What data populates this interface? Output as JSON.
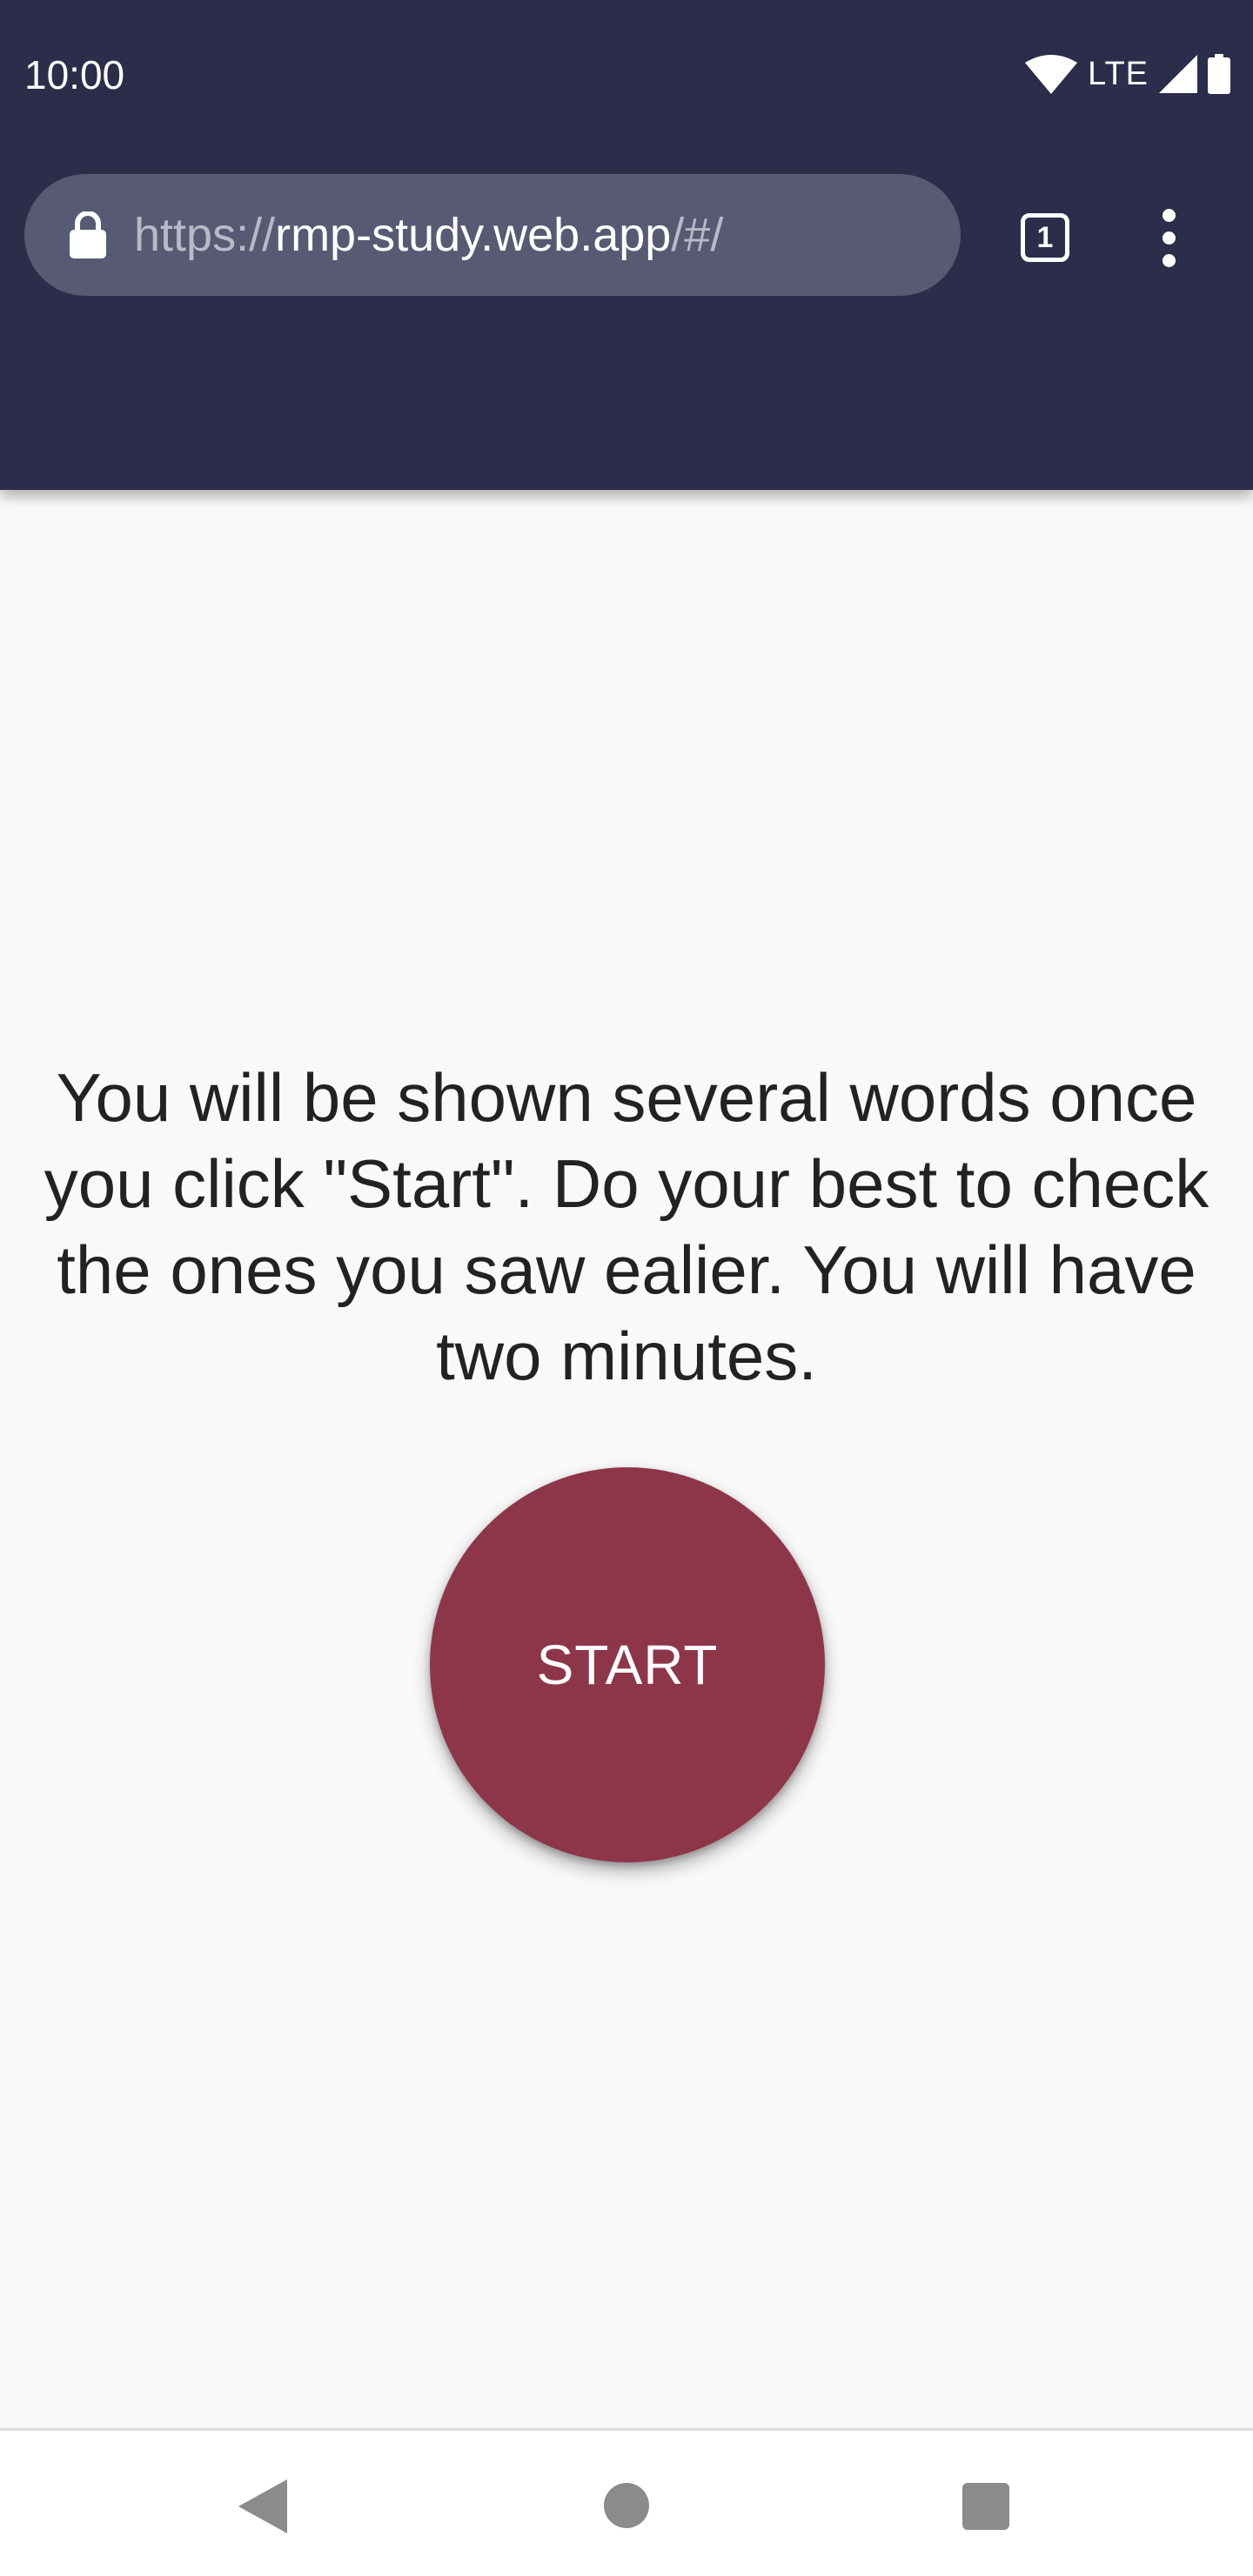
{
  "status_bar": {
    "time": "10:00",
    "network_label": "LTE",
    "icons": [
      "wifi-icon",
      "cell-signal-icon",
      "battery-icon"
    ]
  },
  "browser": {
    "url_scheme": "https://",
    "url_host": "rmp-study.web.app",
    "url_path": "/#/",
    "tab_count": "1",
    "icons": [
      "lock-icon",
      "tabs-icon",
      "more-vert-icon"
    ]
  },
  "main": {
    "instructions": "You will be shown several words once you click \"Start\". Do your best to check the ones you saw ealier. You will have two minutes.",
    "start_label": "START"
  },
  "nav_bar": {
    "icons": [
      "back-icon",
      "home-icon",
      "recents-icon"
    ]
  },
  "colors": {
    "toolbar": "#2c2d4a",
    "url_bar": "#575a72",
    "background": "#f9f9f9",
    "start_button": "#8e3649"
  }
}
